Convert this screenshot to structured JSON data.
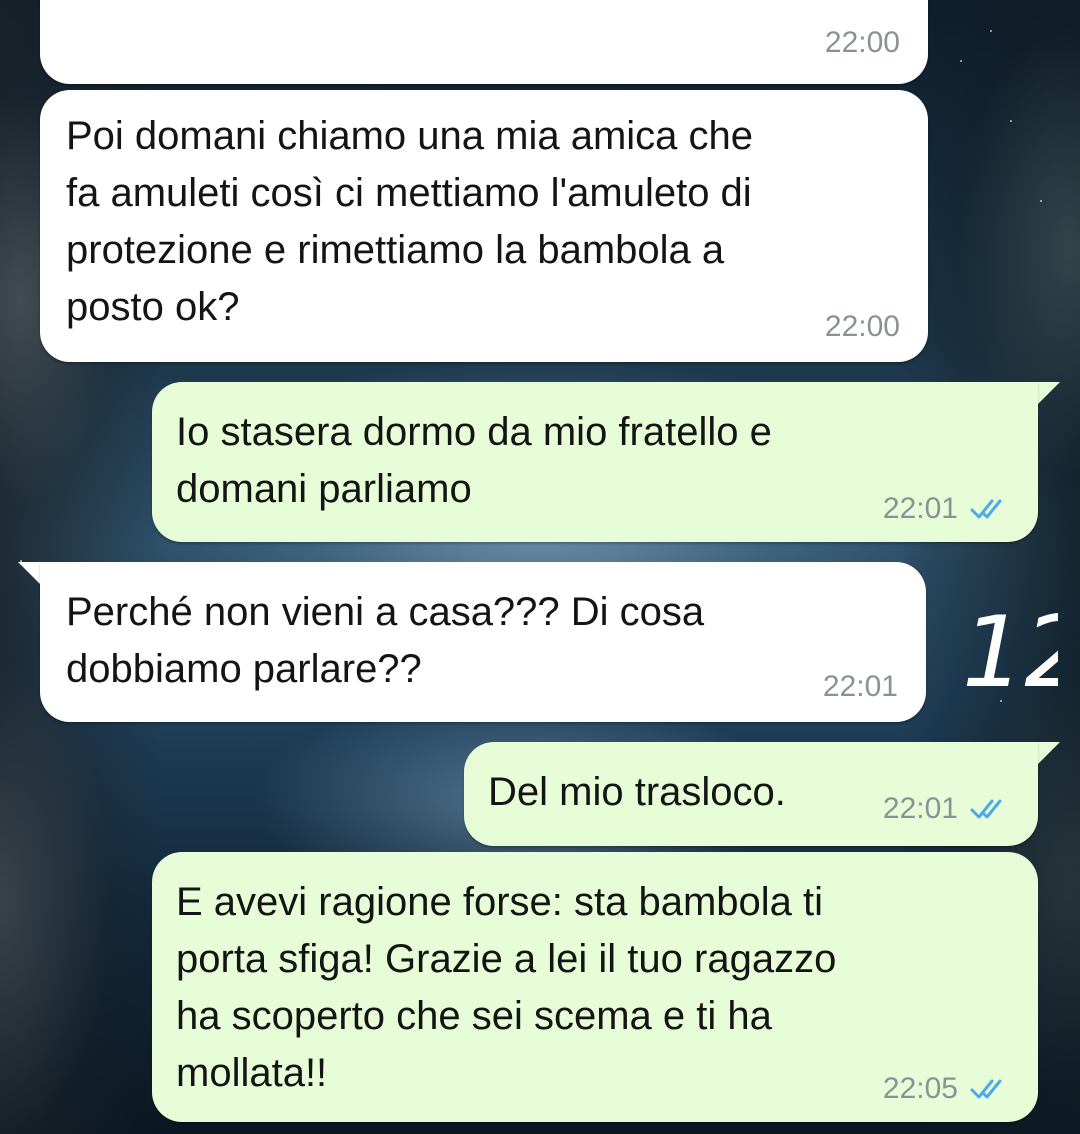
{
  "messages": [
    {
      "id": "m0",
      "direction": "incoming",
      "text": "",
      "time": "22:00"
    },
    {
      "id": "m1",
      "direction": "incoming",
      "text": "Poi domani chiamo una mia amica che\nfa amuleti così ci mettiamo l'amuleto di\nprotezione e rimettiamo la bambola a\nposto ok?",
      "time": "22:00"
    },
    {
      "id": "m2",
      "direction": "outgoing",
      "text": "Io stasera dormo da mio fratello e\ndomani parliamo",
      "time": "22:01",
      "status": "read"
    },
    {
      "id": "m3",
      "direction": "incoming",
      "text": "Perché non vieni a casa??? Di cosa\ndobbiamo parlare??",
      "time": "22:01"
    },
    {
      "id": "m4",
      "direction": "outgoing",
      "text": "Del mio trasloco.",
      "time": "22:01",
      "status": "read"
    },
    {
      "id": "m5",
      "direction": "outgoing",
      "text": "E avevi ragione forse: sta bambola ti\nporta sfiga! Grazie a lei il tuo ragazzo\nha scoperto che sei scema e ti ha\nmollata!!",
      "time": "22:05",
      "status": "read"
    }
  ],
  "annotation": {
    "text": "12"
  },
  "colors": {
    "incoming_bubble": "#ffffff",
    "outgoing_bubble": "#e7fdd8",
    "read_ticks": "#4fa9e8",
    "timestamp": "#8b9296"
  },
  "icons": {
    "read_receipt": "double-check-icon"
  }
}
